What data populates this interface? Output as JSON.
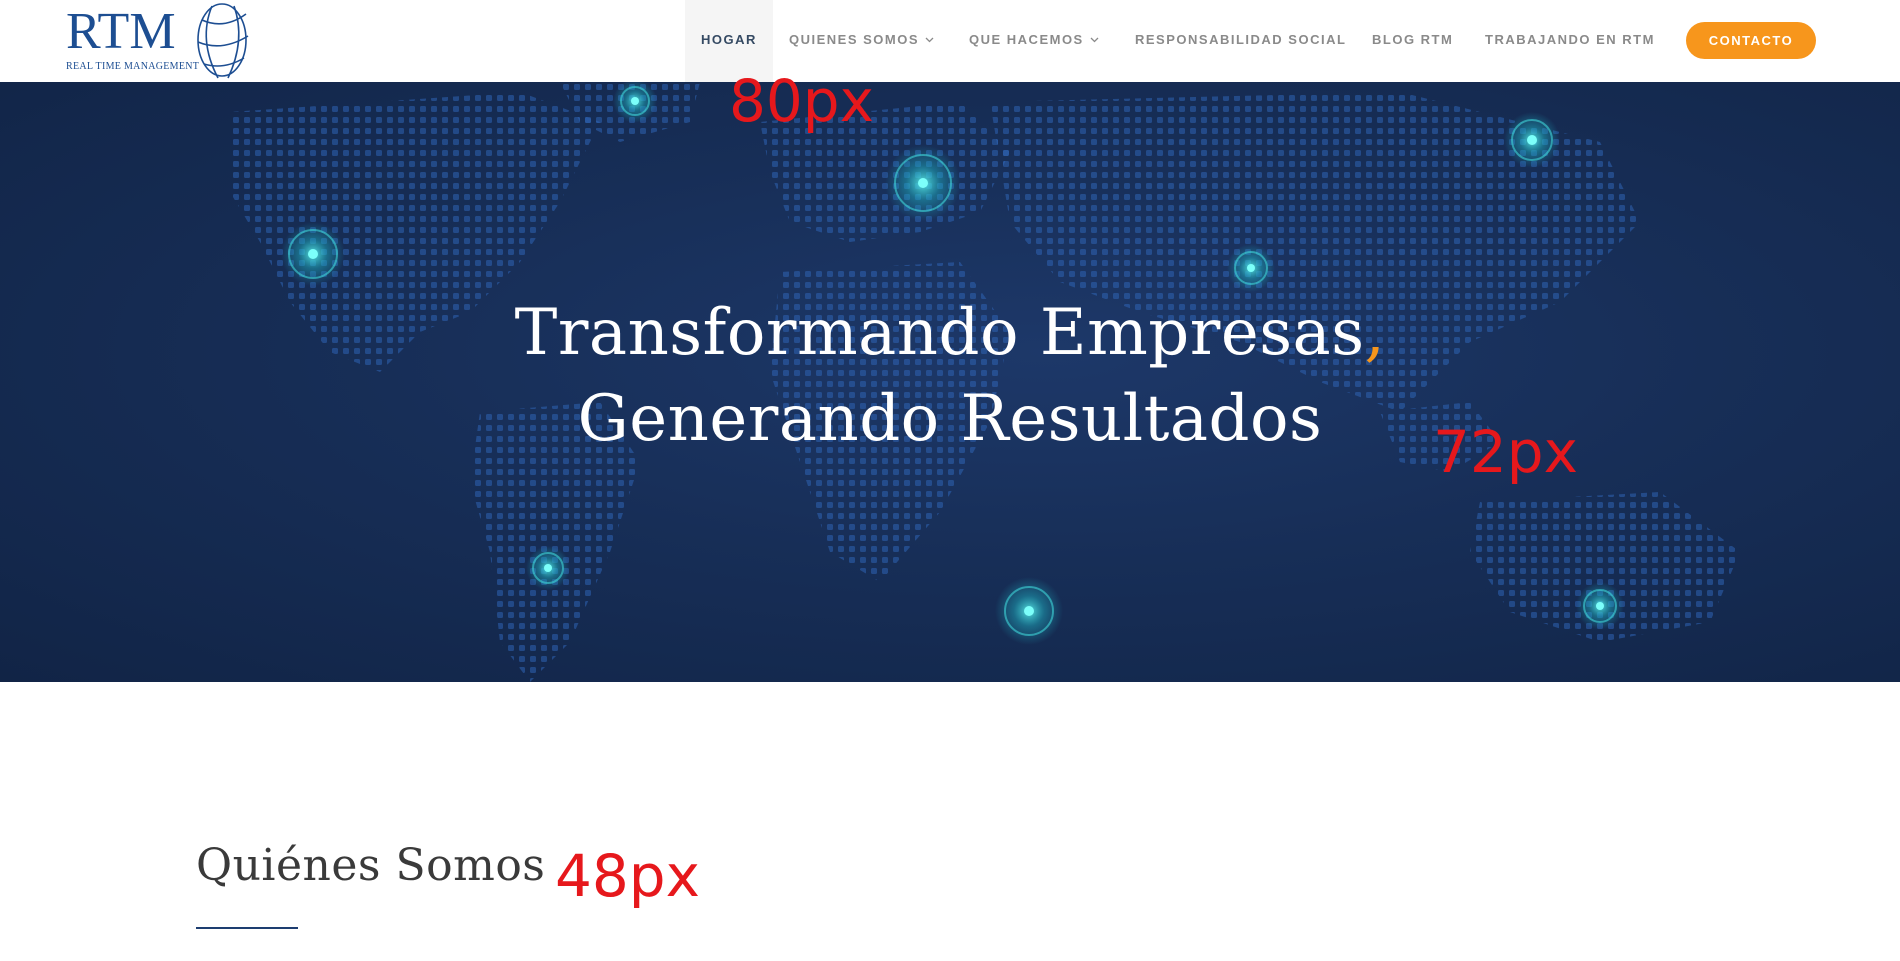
{
  "brand": {
    "logo_text": "RTM",
    "logo_subtitle": "REAL TIME MANAGEMENT",
    "primary_color": "#1d4e92",
    "accent_color": "#f7961c"
  },
  "nav": {
    "items": [
      {
        "label": "HOGAR",
        "active": true,
        "dropdown": false
      },
      {
        "label": "QUIENES SOMOS",
        "active": false,
        "dropdown": true
      },
      {
        "label": "QUE HACEMOS",
        "active": false,
        "dropdown": true
      },
      {
        "label": "RESPONSABILIDAD SOCIAL",
        "active": false,
        "dropdown": false
      },
      {
        "label": "BLOG RTM",
        "active": false,
        "dropdown": false
      },
      {
        "label": "TRABAJANDO EN RTM",
        "active": false,
        "dropdown": false
      }
    ],
    "cta_label": "CONTACTO"
  },
  "hero": {
    "line1": "Transformando Empresas",
    "comma": ",",
    "line2": "Generando Resultados",
    "background": "world-map-dots"
  },
  "annotations": {
    "a80": "80px",
    "a72": "72px",
    "a48": "48px"
  },
  "about": {
    "title": "Quiénes Somos"
  }
}
